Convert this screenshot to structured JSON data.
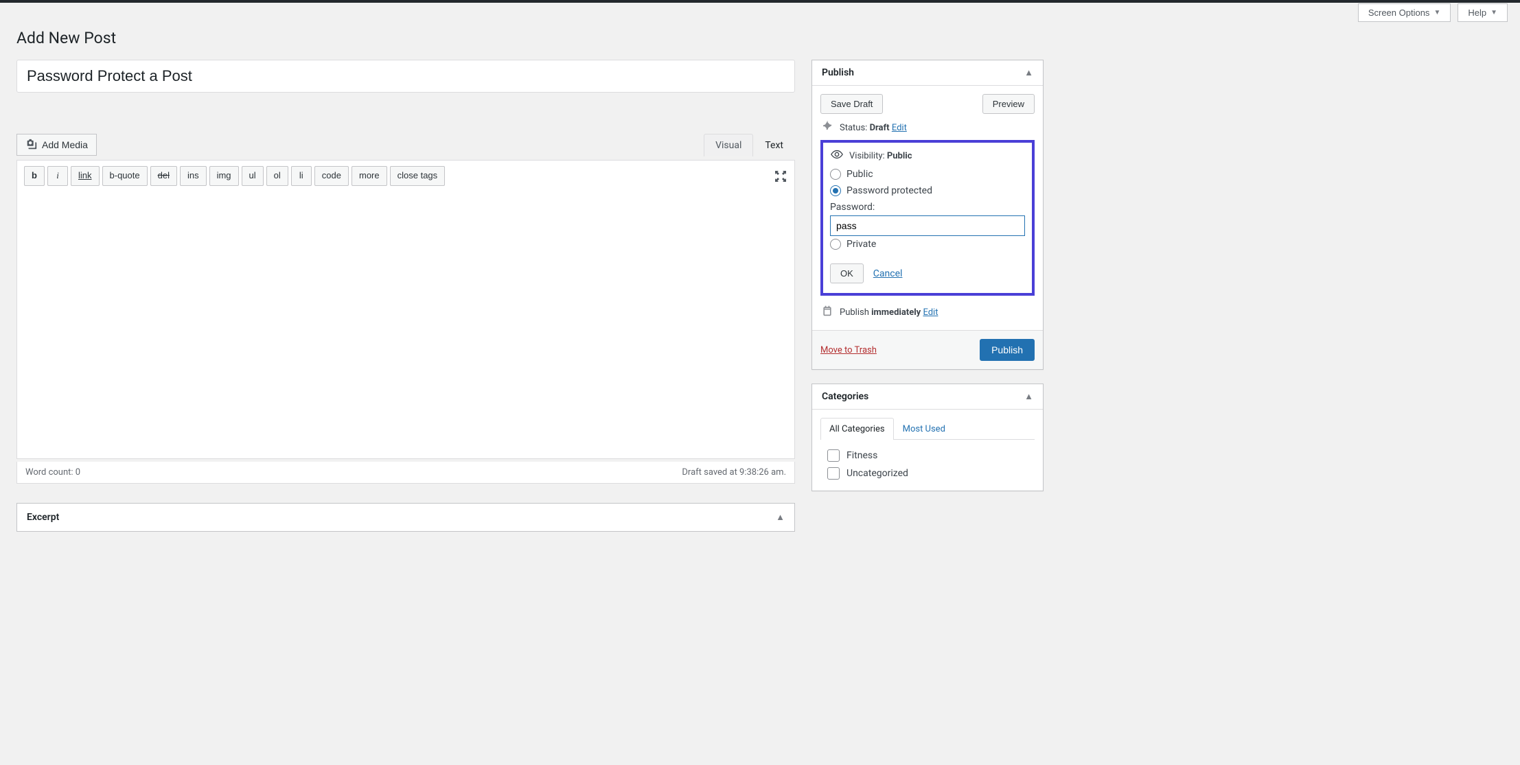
{
  "screen": {
    "options": "Screen Options",
    "help": "Help"
  },
  "page_title": "Add New Post",
  "title_value": "Password Protect a Post",
  "media": {
    "add_media": "Add Media"
  },
  "tabs": {
    "visual": "Visual",
    "text": "Text"
  },
  "quicktags": {
    "b": "b",
    "i": "i",
    "link": "link",
    "bquote": "b-quote",
    "del": "del",
    "ins": "ins",
    "img": "img",
    "ul": "ul",
    "ol": "ol",
    "li": "li",
    "code": "code",
    "more": "more",
    "close": "close tags"
  },
  "status_row": {
    "word_count": "Word count: 0",
    "draft_saved": "Draft saved at 9:38:26 am."
  },
  "publish": {
    "title": "Publish",
    "save_draft": "Save Draft",
    "preview": "Preview",
    "status_label": "Status:",
    "status_value": "Draft",
    "edit": "Edit",
    "visibility_label": "Visibility:",
    "visibility_value": "Public",
    "vis_public": "Public",
    "vis_password": "Password protected",
    "vis_private": "Private",
    "password_label": "Password:",
    "password_value": "pass",
    "ok": "OK",
    "cancel": "Cancel",
    "publish_label": "Publish",
    "publish_value": "immediately",
    "trash": "Move to Trash",
    "publish_btn": "Publish"
  },
  "excerpt": {
    "title": "Excerpt"
  },
  "categories": {
    "title": "Categories",
    "tab_all": "All Categories",
    "tab_most": "Most Used",
    "items": [
      "Fitness",
      "Uncategorized"
    ]
  }
}
